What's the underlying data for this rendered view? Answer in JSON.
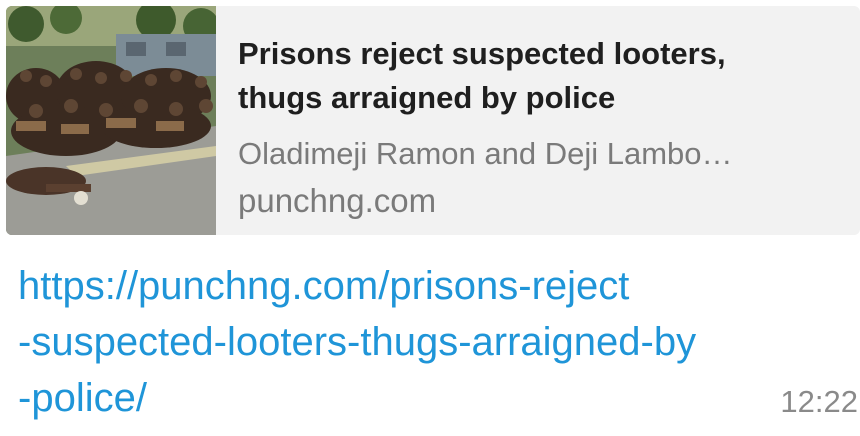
{
  "preview": {
    "title_line1": "Prisons reject suspected looters,",
    "title_line2": "thugs arraigned by police",
    "authors": "Oladimeji Ramon  and Deji Lambo…",
    "domain": "punchng.com",
    "thumbnail": "crowd-photo"
  },
  "message": {
    "url_line1": "https://punchng.com/prisons-reject",
    "url_line2": "-suspected-looters-thugs-arraigned-by",
    "url_line3": "-police/",
    "time": "12:22"
  },
  "colors": {
    "link": "#1f95d8",
    "preview_bg": "#f2f2f2",
    "title": "#1f1f1f",
    "meta": "#7a7a7a"
  }
}
